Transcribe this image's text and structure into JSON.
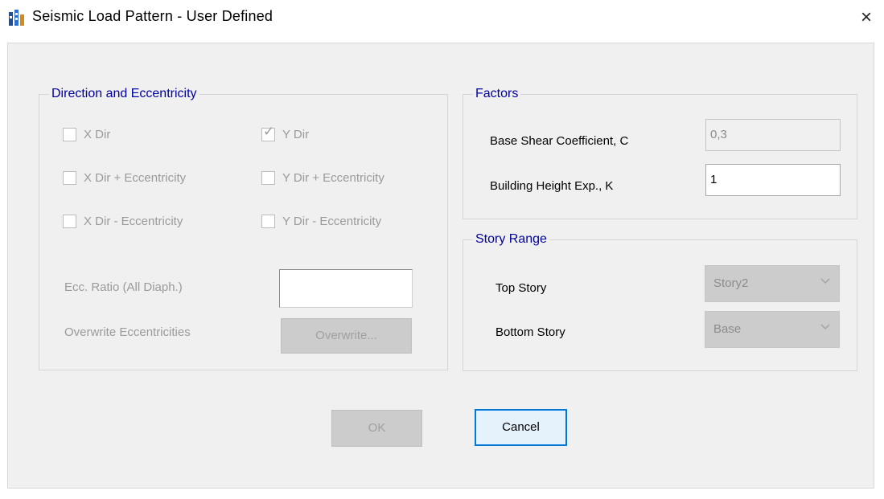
{
  "window": {
    "title": "Seismic Load Pattern - User Defined",
    "close_label": "×"
  },
  "direction_group": {
    "title": "Direction and Eccentricity",
    "checkboxes": [
      {
        "label": "X Dir",
        "checked": false
      },
      {
        "label": "Y Dir",
        "checked": true
      },
      {
        "label": "X Dir + Eccentricity",
        "checked": false
      },
      {
        "label": "Y Dir + Eccentricity",
        "checked": false
      },
      {
        "label": "X Dir - Eccentricity",
        "checked": false
      },
      {
        "label": "Y Dir - Eccentricity",
        "checked": false
      }
    ],
    "ecc_ratio_label": "Ecc. Ratio (All Diaph.)",
    "ecc_ratio_value": "",
    "overwrite_label": "Overwrite Eccentricities",
    "overwrite_button": "Overwrite..."
  },
  "factors_group": {
    "title": "Factors",
    "base_shear_label": "Base Shear Coefficient, C",
    "base_shear_value": "0,3",
    "height_exp_label": "Building Height Exp., K",
    "height_exp_value": "1"
  },
  "story_range_group": {
    "title": "Story Range",
    "top_story_label": "Top Story",
    "top_story_value": "Story2",
    "bottom_story_label": "Bottom Story",
    "bottom_story_value": "Base"
  },
  "buttons": {
    "ok": "OK",
    "cancel": "Cancel"
  },
  "colors": {
    "group_title": "#0000a0",
    "focus_border": "#0078d7"
  },
  "icons": {
    "app": "etabs-app-icon",
    "close": "close-icon",
    "dropdown": "chevron-down-icon",
    "check": "checkmark-icon"
  }
}
